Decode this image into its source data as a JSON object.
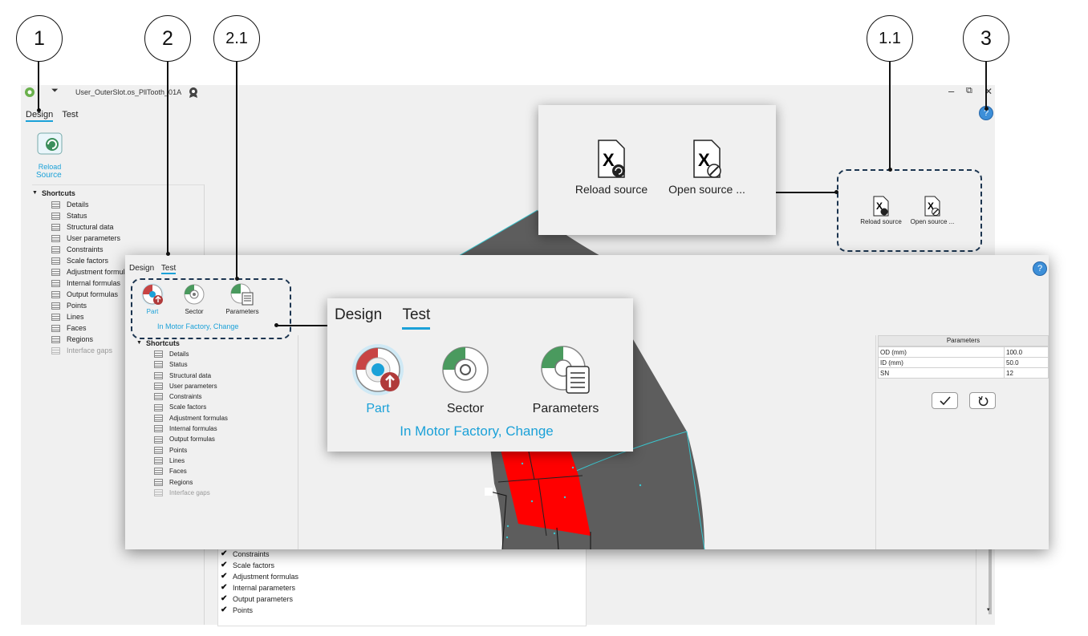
{
  "callouts": [
    "1",
    "2",
    "2.1",
    "1.1",
    "3"
  ],
  "back_window": {
    "title": "User_OuterSlot.os_PllTooth_01A",
    "tabs": [
      "Design",
      "Test"
    ],
    "reload_label_line1": "Reload",
    "reload_label_line2": "Source",
    "window_min": "–",
    "window_restore": "⧉",
    "window_close": "✕",
    "help": "?",
    "shortcuts_header": "Shortcuts",
    "shortcuts": [
      "Details",
      "Status",
      "Structural data",
      "User parameters",
      "Constraints",
      "Scale factors",
      "Adjustment formulas",
      "Internal formulas",
      "Output formulas",
      "Points",
      "Lines",
      "Faces",
      "Regions",
      "Interface gaps"
    ],
    "checklist": [
      "Constraints",
      "Scale factors",
      "Adjustment formulas",
      "Internal parameters",
      "Output parameters",
      "Points"
    ],
    "small_reload": "Reload source",
    "small_open": "Open source ..."
  },
  "zoom_source": {
    "reload": "Reload source",
    "open": "Open source ..."
  },
  "front_window": {
    "tabs": [
      "Design",
      "Test"
    ],
    "buttons": [
      "Part",
      "Sector",
      "Parameters"
    ],
    "caption": "In Motor Factory, Change",
    "help": "?",
    "shortcuts_header": "Shortcuts",
    "shortcuts": [
      "Details",
      "Status",
      "Structural data",
      "User parameters",
      "Constraints",
      "Scale factors",
      "Adjustment formulas",
      "Internal formulas",
      "Output formulas",
      "Points",
      "Lines",
      "Faces",
      "Regions",
      "Interface gaps"
    ],
    "params_header": "Parameters",
    "params": [
      {
        "name": "OD (mm)",
        "value": "100.0"
      },
      {
        "name": "ID (mm)",
        "value": "50.0"
      },
      {
        "name": "SN",
        "value": "12"
      }
    ]
  },
  "zoom_test": {
    "tabs": [
      "Design",
      "Test"
    ],
    "buttons": [
      "Part",
      "Sector",
      "Parameters"
    ],
    "caption": "In Motor Factory, Change"
  },
  "colors": {
    "accent": "#1ba1d8",
    "dashed": "#1c3550",
    "region_red": "#ff0000",
    "shape_gray": "#5d5d5d"
  }
}
